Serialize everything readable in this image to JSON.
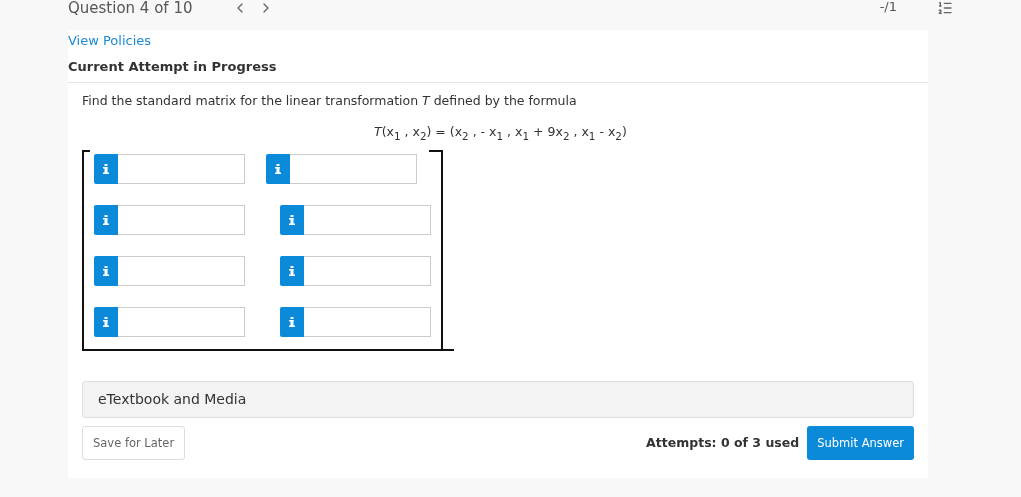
{
  "header": {
    "question": "Question 4 of 10",
    "score": "-/1"
  },
  "policies_link": "View Policies",
  "attempt_status": "Current Attempt in Progress",
  "question": {
    "prompt": "Find the standard matrix for the linear transformation *T* defined by the formula",
    "formula": "*T*(x$_{1}$ , x$_{2}$) = (x$_{2}$ , - x$_{1}$ , x$_{1}$ + 9x$_{2}$ , x$_{1}$ - x$_{2}$)"
  },
  "matrix_rows": [
    {
      "cells": [
        {
          "kind": "input"
        },
        {
          "kind": "input"
        }
      ]
    },
    {
      "cells": [
        {
          "kind": "input"
        },
        {
          "kind": "input"
        }
      ]
    },
    {
      "cells": [
        {
          "kind": "input"
        },
        {
          "kind": "input"
        }
      ]
    },
    {
      "cells": [
        {
          "kind": "input"
        },
        {
          "kind": "input"
        }
      ]
    }
  ],
  "resources": {
    "label": "eTextbook and Media"
  },
  "footer": {
    "save_button": "Save for Later",
    "attempts": "Attempts: 0 of 3 used",
    "submit_button": "Submit Answer"
  }
}
